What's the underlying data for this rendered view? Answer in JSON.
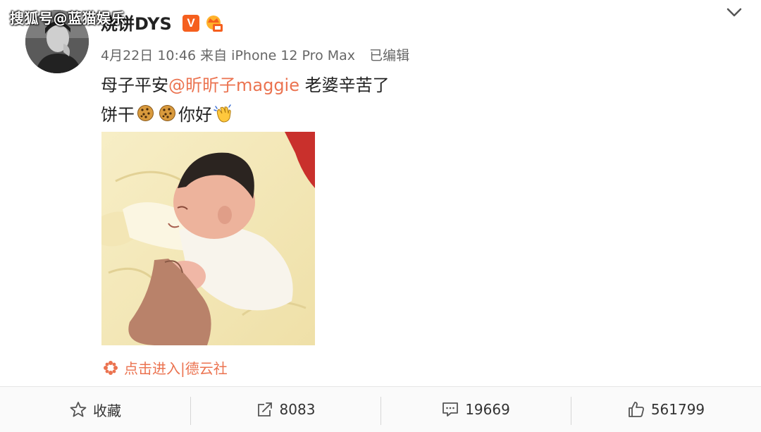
{
  "watermark": "搜狐号@蓝猫娱乐",
  "user": {
    "name": "烧饼DYS",
    "verified_badge": "V"
  },
  "meta": {
    "date": "4月22日",
    "time": "10:46",
    "source": "来自 iPhone 12 Pro Max",
    "edited": "已编辑"
  },
  "post": {
    "line1_prefix": "母子平安",
    "mention": "@昕昕子maggie",
    "line1_suffix": " 老婆辛苦了",
    "line2_prefix": "饼干",
    "line2_suffix": "你好"
  },
  "link": {
    "label": "点击进入|德云社"
  },
  "actions": {
    "favorite": "收藏",
    "repost": "8083",
    "comment": "19669",
    "like": "561799"
  },
  "colors": {
    "accent": "#eb7350",
    "badge": "#f55f1e"
  },
  "icons": [
    "chevron-down-icon",
    "cookie-emoji-icon",
    "waving-hand-icon",
    "link-flower-icon",
    "star-icon",
    "repost-icon",
    "comment-icon",
    "thumbs-up-icon"
  ]
}
